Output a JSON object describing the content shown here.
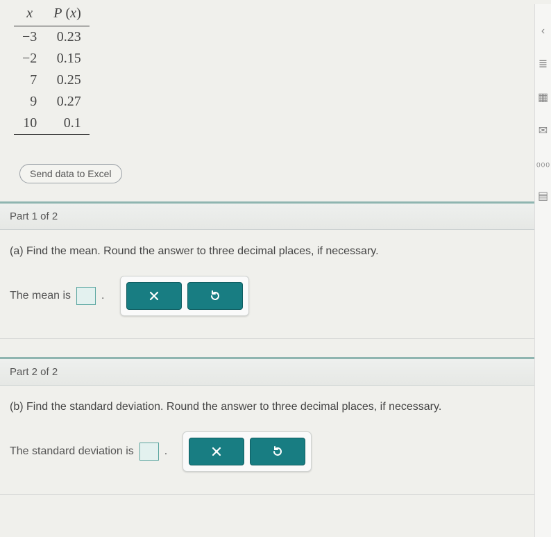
{
  "table": {
    "headers": {
      "x": "x",
      "px": "P (x)"
    },
    "rows": [
      {
        "x": "−3",
        "px": "0.23"
      },
      {
        "x": "−2",
        "px": "0.15"
      },
      {
        "x": "7",
        "px": "0.25"
      },
      {
        "x": "9",
        "px": "0.27"
      },
      {
        "x": "10",
        "px": "0.1"
      }
    ]
  },
  "excel_button": "Send data to Excel",
  "part1": {
    "header": "Part 1 of 2",
    "question": "(a) Find the mean. Round the answer to three decimal places, if necessary.",
    "label_before": "The mean is",
    "label_after": "."
  },
  "part2": {
    "header": "Part 2 of 2",
    "question": "(b) Find the standard deviation. Round the answer to three decimal places, if necessary.",
    "label_before": "The standard deviation is",
    "label_after": "."
  },
  "icons": {
    "close": "×",
    "reset": "↺"
  },
  "rail": {
    "back": "‹",
    "list": "≣",
    "calc": "▦",
    "mail": "✉",
    "chart": "₀₀₀",
    "notes": "▤"
  }
}
